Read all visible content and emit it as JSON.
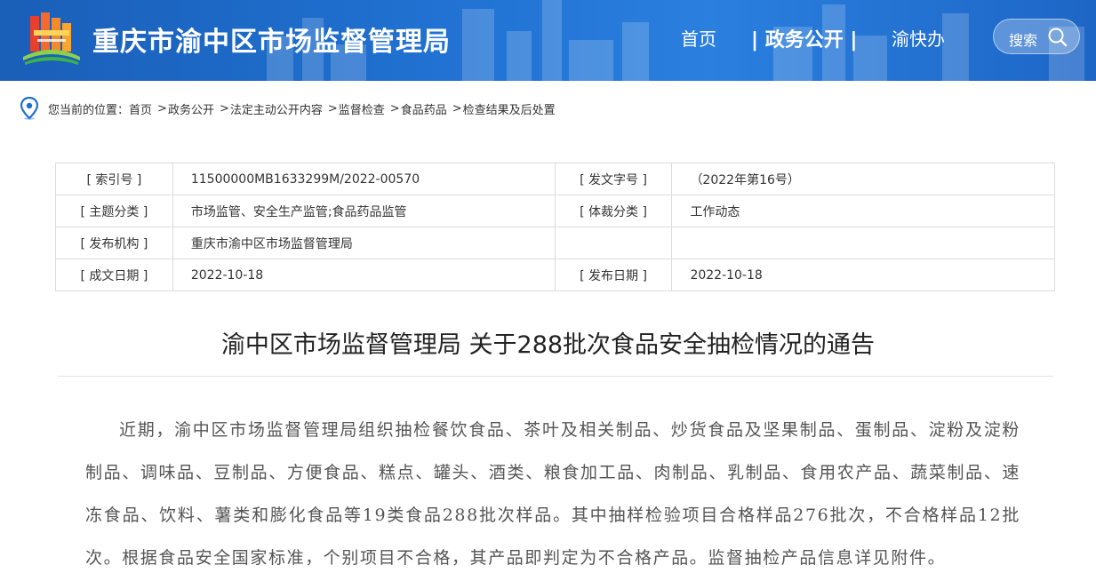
{
  "header": {
    "site_title": "重庆市渝中区市场监督管理局",
    "nav": {
      "home": "首页",
      "affairs": "| 政务公开 |",
      "ykb": "渝快办"
    },
    "search_label": "搜索"
  },
  "breadcrumb": {
    "prefix": "您当前的位置：",
    "items": [
      "首页",
      "政务公开",
      "法定主动公开内容",
      "监督检查",
      "食品药品",
      "检查结果及后处置"
    ],
    "separator": ">"
  },
  "meta": {
    "rows": [
      {
        "label1": "[ 索引号 ]",
        "value1": "11500000MB1633299M/2022-00570",
        "label2": "[ 发文字号 ]",
        "value2": "（2022年第16号）"
      },
      {
        "label1": "[ 主题分类 ]",
        "value1": "市场监管、安全生产监管;食品药品监管",
        "label2": "[ 体裁分类 ]",
        "value2": "工作动态"
      },
      {
        "label1": "[ 发布机构 ]",
        "value1": "重庆市渝中区市场监督管理局",
        "label2": "",
        "value2": ""
      },
      {
        "label1": "[ 成文日期 ]",
        "value1": "2022-10-18",
        "label2": "[ 发布日期 ]",
        "value2": "2022-10-18"
      }
    ]
  },
  "article": {
    "title": "渝中区市场监督管理局 关于288批次食品安全抽检情况的通告",
    "body": "近期，渝中区市场监督管理局组织抽检餐饮食品、茶叶及相关制品、炒货食品及坚果制品、蛋制品、淀粉及淀粉制品、调味品、豆制品、方便食品、糕点、罐头、酒类、粮食加工品、肉制品、乳制品、食用农产品、蔬菜制品、速冻食品、饮料、薯类和膨化食品等19类食品288批次样品。其中抽样检验项目合格样品276批次，不合格样品12批次。根据食品安全国家标准，个别项目不合格，其产品即判定为不合格产品。监督抽检产品信息详见附件。"
  }
}
